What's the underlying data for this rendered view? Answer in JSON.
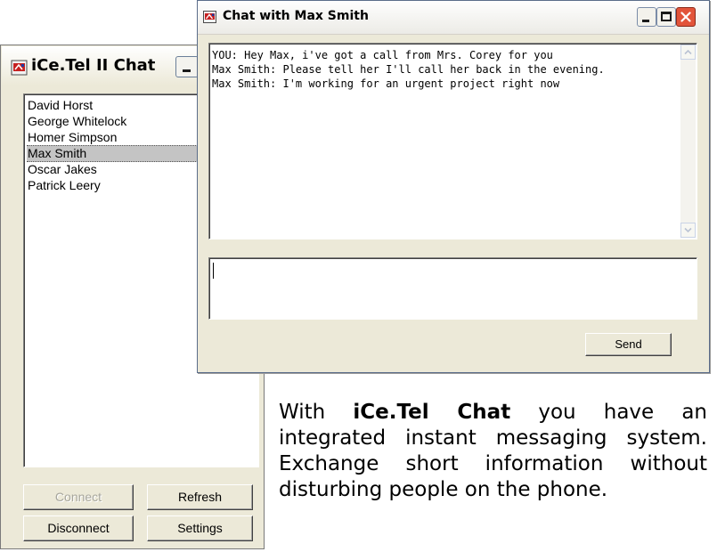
{
  "contacts_window": {
    "title": "iCe.Tel II Chat",
    "contacts": [
      "David Horst",
      "George Whitelock",
      "Homer Simpson",
      "Max Smith",
      "Oscar Jakes",
      "Patrick Leery"
    ],
    "selected_contact": "Max Smith",
    "buttons": {
      "connect": "Connect",
      "refresh": "Refresh",
      "disconnect": "Disconnect",
      "settings": "Settings"
    }
  },
  "chat_window": {
    "title": "Chat with Max Smith",
    "messages": [
      "YOU: Hey Max, i've got a call from Mrs. Corey for you",
      "Max Smith: Please tell her I'll call her back in the evening.",
      "Max Smith: I'm working for an urgent project right now"
    ],
    "input_value": "",
    "send_label": "Send"
  },
  "caption": {
    "prefix": "With ",
    "product": "iCe.Tel Chat",
    "text": " you have an integrated instant messaging system. Exchange short information without disturbing people on the phone."
  },
  "colors": {
    "window_face": "#ece9d8",
    "close_button": "#e2543a",
    "selection": "#c4c4c4"
  },
  "icons": [
    "app-icon",
    "minimize-icon",
    "maximize-icon",
    "close-icon",
    "scroll-up-arrow-icon",
    "scroll-down-arrow-icon"
  ]
}
